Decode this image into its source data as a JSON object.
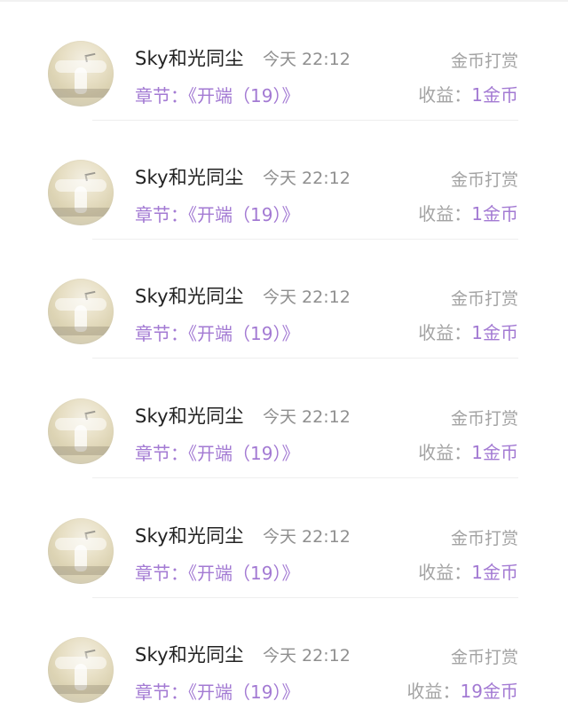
{
  "colors": {
    "accent_purple": "#a37ad3",
    "text_primary": "#222222",
    "text_secondary": "#a3a3a3",
    "divider": "#eeeeee"
  },
  "rows": [
    {
      "user": "Sky和光同尘",
      "time": "今天 22:12",
      "type": "金币打赏",
      "chapter_label": "章节：",
      "chapter_title": "《开端（19）》",
      "income_label": "收益：",
      "income_amount": "1金币",
      "avatar_icon": "cat-avatar-icon"
    },
    {
      "user": "Sky和光同尘",
      "time": "今天 22:12",
      "type": "金币打赏",
      "chapter_label": "章节：",
      "chapter_title": "《开端（19）》",
      "income_label": "收益：",
      "income_amount": "1金币",
      "avatar_icon": "cat-avatar-icon"
    },
    {
      "user": "Sky和光同尘",
      "time": "今天 22:12",
      "type": "金币打赏",
      "chapter_label": "章节：",
      "chapter_title": "《开端（19）》",
      "income_label": "收益：",
      "income_amount": "1金币",
      "avatar_icon": "cat-avatar-icon"
    },
    {
      "user": "Sky和光同尘",
      "time": "今天 22:12",
      "type": "金币打赏",
      "chapter_label": "章节：",
      "chapter_title": "《开端（19）》",
      "income_label": "收益：",
      "income_amount": "1金币",
      "avatar_icon": "cat-avatar-icon"
    },
    {
      "user": "Sky和光同尘",
      "time": "今天 22:12",
      "type": "金币打赏",
      "chapter_label": "章节：",
      "chapter_title": "《开端（19）》",
      "income_label": "收益：",
      "income_amount": "1金币",
      "avatar_icon": "cat-avatar-icon"
    },
    {
      "user": "Sky和光同尘",
      "time": "今天 22:12",
      "type": "金币打赏",
      "chapter_label": "章节：",
      "chapter_title": "《开端（19）》",
      "income_label": "收益：",
      "income_amount": "19金币",
      "avatar_icon": "cat-avatar-icon"
    }
  ]
}
